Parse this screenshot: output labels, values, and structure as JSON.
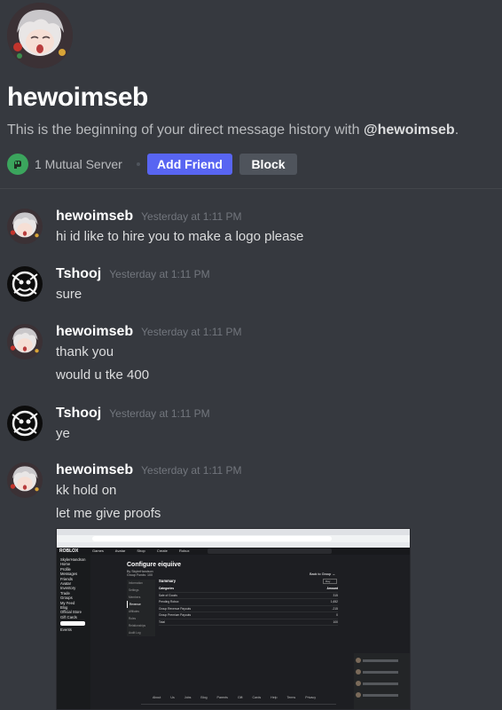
{
  "header": {
    "username": "hewoimseb",
    "intro_prefix": "This is the beginning of your direct message history with ",
    "intro_handle": "@hewoimseb",
    "intro_suffix": ".",
    "mutual_servers": "1 Mutual Server",
    "add_friend_label": "Add Friend",
    "block_label": "Block"
  },
  "messages": [
    {
      "author": "hewoimseb",
      "time": "Yesterday at 1:11 PM",
      "lines": [
        "hi id like to hire you to make a logo please"
      ]
    },
    {
      "author": "Tshooj",
      "time": "Yesterday at 1:11 PM",
      "lines": [
        "sure"
      ]
    },
    {
      "author": "hewoimseb",
      "time": "Yesterday at 1:11 PM",
      "lines": [
        "thank you",
        "would u tke 400"
      ]
    },
    {
      "author": "Tshooj",
      "time": "Yesterday at 1:11 PM",
      "lines": [
        "ye"
      ]
    },
    {
      "author": "hewoimseb",
      "time": "Yesterday at 1:11 PM",
      "lines": [
        "kk hold on",
        "let me give proofs"
      ]
    }
  ],
  "attachment": {
    "logo": "ROBLOX",
    "nav_links": "Games Avatar Shop Create Robux",
    "sidebar": [
      "SkylerHandson",
      "Home",
      "Profile",
      "Messages",
      "Friends",
      "Avatar",
      "Inventory",
      "Trade",
      "Groups",
      "My Feed",
      "Blog",
      "Official Store",
      "Gift Cards"
    ],
    "premium": "",
    "events": "Events",
    "title": "Configure eiquiive",
    "subtitle_by": "By SkylerHandson",
    "subtitle_funds": "Group Funds: 100",
    "back_link": "Back to Group →",
    "menu": [
      "Information",
      "Settings",
      "Members",
      "Revenue",
      "Affiliates",
      "Roles",
      "Relationships",
      "Audit Log"
    ],
    "summary": "Summary",
    "day": "Day",
    "table_header": [
      "Categories",
      "Amount"
    ],
    "table_rows": [
      [
        "Sale of Goods",
        "315"
      ],
      [
        "Pending Robux",
        "1,652"
      ],
      [
        "Group Revenue Payouts",
        "-215"
      ],
      [
        "Group Premium Payouts",
        "0"
      ],
      [
        "Total",
        "100"
      ]
    ],
    "footer_links": "About Us Jobs Blog Parents Gift Cards Help Terms Privacy"
  },
  "colors": {
    "background": "#36393f",
    "accent": "#5865f2",
    "block_button": "#4f545c",
    "server_icon": "#3ba55d"
  },
  "icons": {
    "server": "fist-icon",
    "avatar_a": "anime-girl-avatar",
    "avatar_b": "black-white-art-avatar"
  }
}
